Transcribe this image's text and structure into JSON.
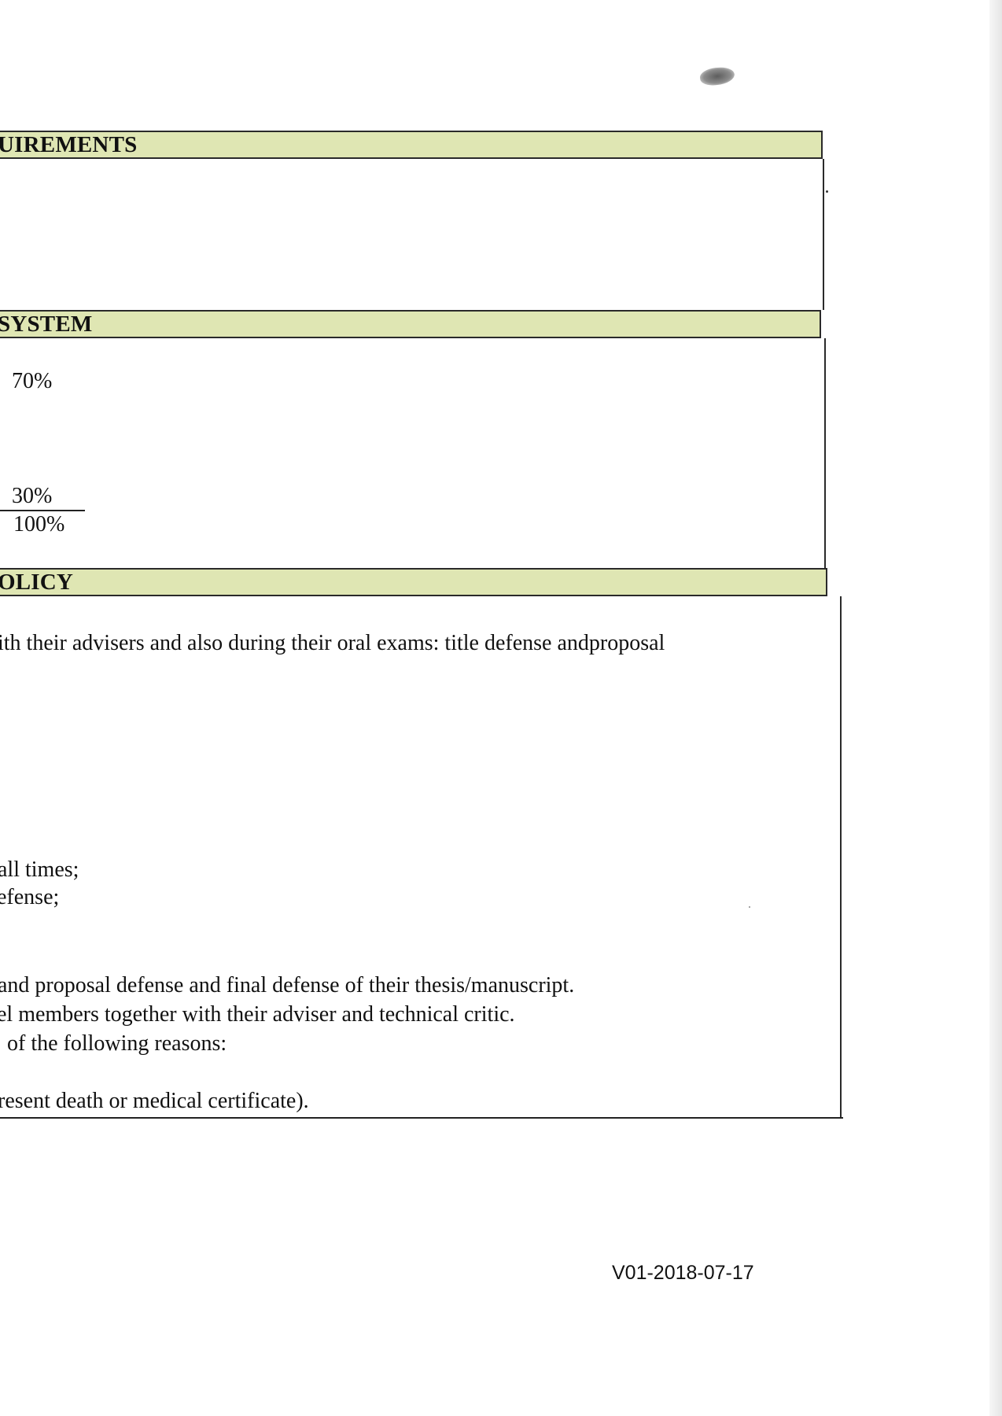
{
  "sections": {
    "requirements": {
      "title": "UIREMENTS"
    },
    "grading": {
      "title": "SYSTEM",
      "value_1": "70%",
      "value_2": "30%",
      "total": "100%"
    },
    "policy": {
      "title": "OLICY",
      "line_1": "ith their advisers and also during their oral exams: title defense andproposal",
      "line_2": "all times;",
      "line_3": "efense;",
      "line_4": "and proposal defense and final defense of their thesis/manuscript.",
      "line_5": "el members together with their adviser and technical critic.",
      "line_6": "of the following reasons:",
      "line_7": "resent death or medical certificate)."
    }
  },
  "footer": {
    "version": "V01-2018-07-17"
  }
}
